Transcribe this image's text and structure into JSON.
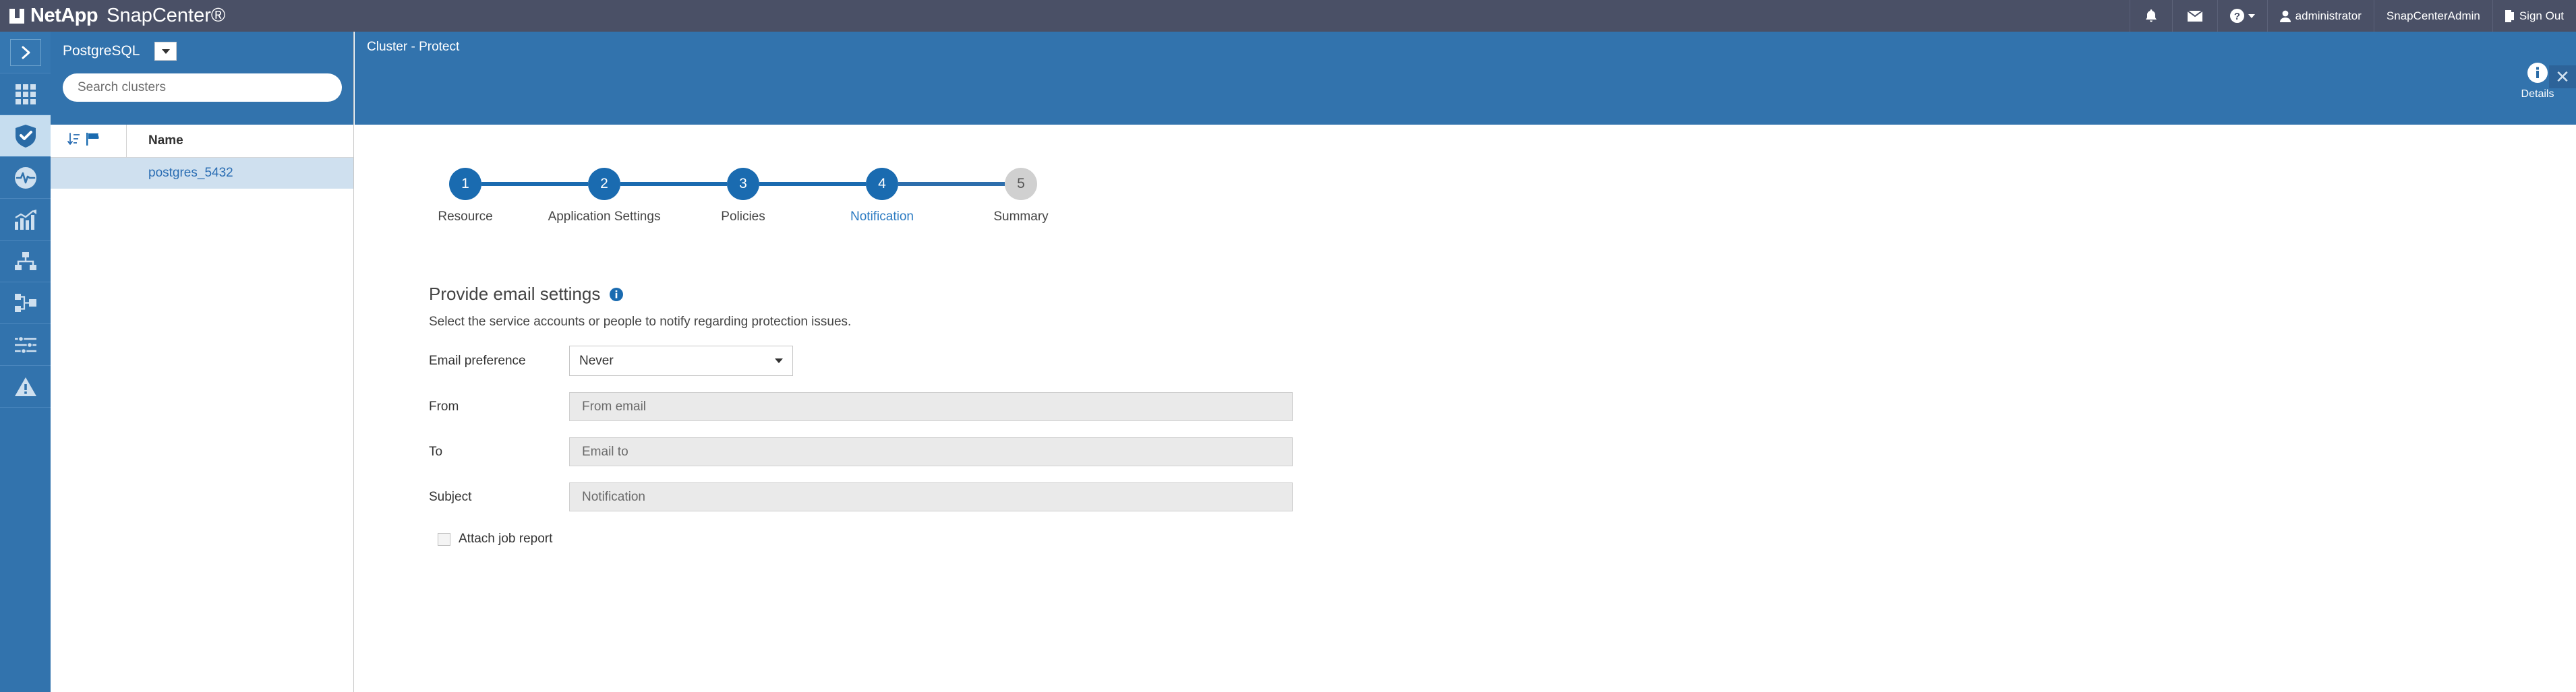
{
  "topbar": {
    "brand_netapp": "NetApp",
    "brand_product": "SnapCenter®",
    "notifications_icon": "bell-icon",
    "mail_icon": "envelope-icon",
    "help_icon": "help-icon",
    "user_icon": "user-icon",
    "user_name": "administrator",
    "role": "SnapCenterAdmin",
    "signout_icon": "signout-icon",
    "signout_label": "Sign Out",
    "background": "#4a5066"
  },
  "rail": {
    "items": [
      {
        "name": "expand-navigation",
        "icon": "chevron-right-icon",
        "active": false
      },
      {
        "name": "dashboard",
        "icon": "grid-icon",
        "active": false
      },
      {
        "name": "resources",
        "icon": "shield-check-icon",
        "active": true
      },
      {
        "name": "monitor",
        "icon": "pulse-icon",
        "active": false
      },
      {
        "name": "reports",
        "icon": "bar-chart-icon",
        "active": false
      },
      {
        "name": "hosts",
        "icon": "hosts-network-icon",
        "active": false
      },
      {
        "name": "storage-systems",
        "icon": "storage-nodes-icon",
        "active": false
      },
      {
        "name": "settings",
        "icon": "sliders-icon",
        "active": false
      },
      {
        "name": "alerts",
        "icon": "warning-triangle-icon",
        "active": false
      }
    ],
    "background": "#3273ad",
    "active_background": "#c6ddef"
  },
  "list_panel": {
    "plugin_title": "PostgreSQL",
    "plugin_dropdown_icon": "chevron-down-icon",
    "search": {
      "value": "",
      "placeholder": "Search clusters"
    },
    "table": {
      "sort_icon": "sort-ascending-icon",
      "flag_icon": "flag-icon",
      "columns": [
        "Name"
      ],
      "rows": [
        {
          "name": "postgres_5432",
          "selected": true
        }
      ]
    }
  },
  "banner": {
    "breadcrumb": "Cluster - Protect",
    "details_icon": "info-circle-icon",
    "details_label": "Details",
    "close_icon": "close-icon",
    "background": "#3273ad"
  },
  "wizard": {
    "steps": [
      {
        "number": "1",
        "label": "Resource",
        "state": "complete"
      },
      {
        "number": "2",
        "label": "Application Settings",
        "state": "complete"
      },
      {
        "number": "3",
        "label": "Policies",
        "state": "complete"
      },
      {
        "number": "4",
        "label": "Notification",
        "state": "current"
      },
      {
        "number": "5",
        "label": "Summary",
        "state": "inactive"
      }
    ],
    "active_color": "#1a6bb0",
    "inactive_color": "#d0d0d0",
    "current_label_color": "#2a7ac2"
  },
  "form": {
    "title": "Provide email settings",
    "title_info_icon": "info-circle-icon",
    "subtitle": "Select the service accounts or people to notify regarding protection issues.",
    "email_preference": {
      "label": "Email preference",
      "value": "Never",
      "caret_icon": "chevron-down-icon"
    },
    "from": {
      "label": "From",
      "value": "",
      "placeholder": "From email",
      "disabled": true
    },
    "to": {
      "label": "To",
      "value": "",
      "placeholder": "Email to",
      "disabled": true
    },
    "subject": {
      "label": "Subject",
      "value": "",
      "placeholder": "Notification",
      "disabled": true
    },
    "attach_job_report": {
      "label": "Attach job report",
      "checked": false
    }
  }
}
